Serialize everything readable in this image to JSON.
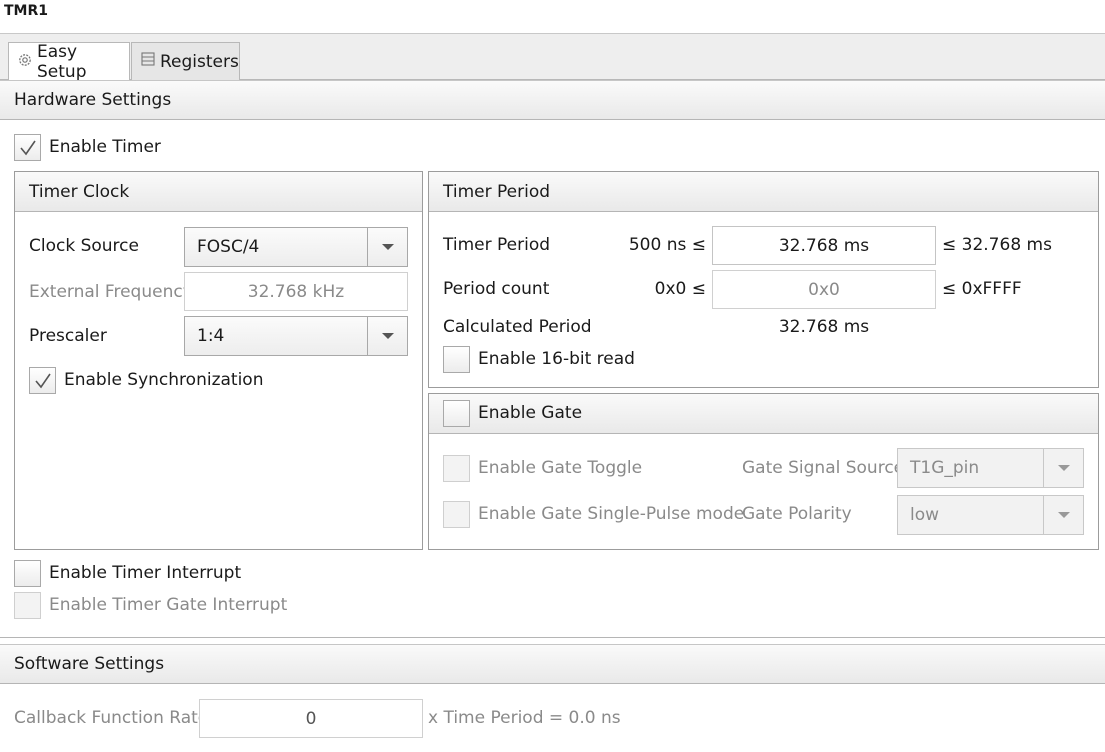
{
  "window": {
    "title": "TMR1"
  },
  "tabs": [
    {
      "label": "Easy Setup",
      "icon": "gear-icon"
    },
    {
      "label": "Registers",
      "icon": "list-icon"
    }
  ],
  "hardware": {
    "header": "Hardware Settings",
    "enable_timer": {
      "label": "Enable Timer",
      "checked": true
    },
    "timer_clock": {
      "header": "Timer Clock",
      "clock_source_label": "Clock Source",
      "clock_source_value": "FOSC/4",
      "external_frequency_label": "External Frequency",
      "external_frequency_value": "32.768 kHz",
      "prescaler_label": "Prescaler",
      "prescaler_value": "1:4",
      "enable_sync": {
        "label": "Enable Synchronization",
        "checked": true
      }
    },
    "timer_period": {
      "header": "Timer Period",
      "period_label": "Timer Period",
      "period_min": "500 ns ≤",
      "period_value": "32.768 ms",
      "period_max": "≤ 32.768 ms",
      "count_label": "Period count",
      "count_min": "0x0 ≤",
      "count_value": "0x0",
      "count_max": "≤ 0xFFFF",
      "calc_label": "Calculated Period",
      "calc_value": "32.768 ms",
      "enable_16bit": {
        "label": "Enable 16-bit read",
        "checked": false
      }
    },
    "gate": {
      "header_label": "Enable Gate",
      "checked": false,
      "toggle_label": "Enable Gate Toggle",
      "single_pulse_label": "Enable Gate Single-Pulse mode",
      "signal_source_label": "Gate Signal Source",
      "signal_source_value": "T1G_pin",
      "polarity_label": "Gate Polarity",
      "polarity_value": "low"
    },
    "enable_timer_interrupt": {
      "label": "Enable Timer Interrupt",
      "checked": false
    },
    "enable_gate_interrupt": {
      "label": "Enable Timer Gate Interrupt",
      "checked": false
    }
  },
  "software": {
    "header": "Software Settings",
    "callback_label": "Callback Function Rate",
    "callback_value": "0",
    "callback_suffix": "x Time Period = 0.0 ns"
  }
}
